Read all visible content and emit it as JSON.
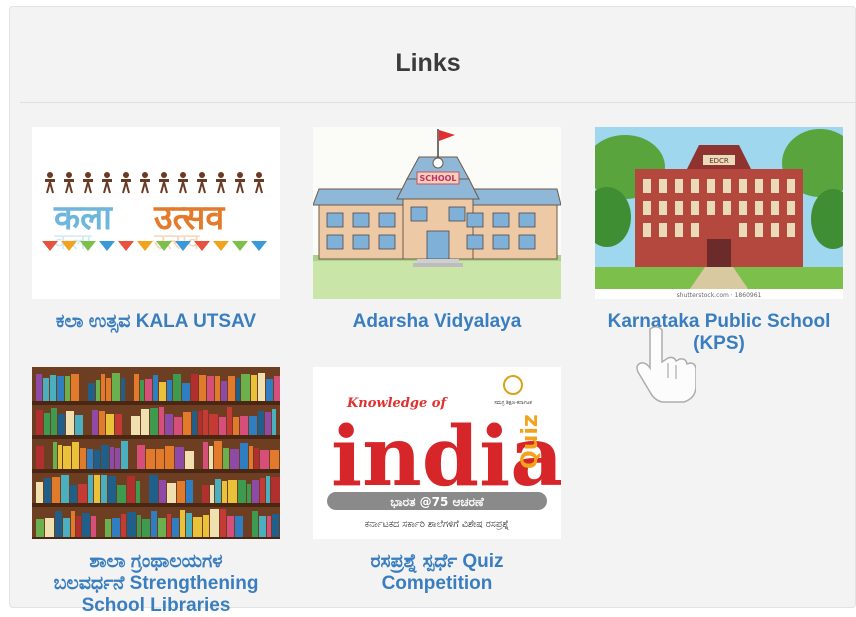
{
  "section": {
    "title": "Links"
  },
  "cards": [
    {
      "label_lines": [
        "ಕಲಾ ಉತ್ಸವ KALA UTSAV"
      ],
      "image": "kala-utsav-logo"
    },
    {
      "label_lines": [
        "Adarsha Vidyalaya"
      ],
      "image": "school-building-drawing",
      "sign_text": "SCHOOL"
    },
    {
      "label_lines": [
        "Karnataka Public School",
        "(KPS)"
      ],
      "image": "public-school-illustration",
      "sign_text": "EDCR",
      "caption": "shutterstock.com · 1860961"
    },
    {
      "label_lines": [
        "ಶಾಲಾ ಗ್ರಂಥಾಲಯಗಳ",
        "ಬಲವರ್ಧನೆ Strengthening",
        "School Libraries"
      ],
      "image": "bookshelf-library"
    },
    {
      "label_lines": [
        "ರಸಪ್ರಶ್ನೆ ಸ್ಪರ್ಧೆ Quiz",
        "Competition"
      ],
      "image": "knowledge-of-india-quiz",
      "quiz": {
        "top": "Knowledge of",
        "main": "india",
        "side": "Quiz",
        "band": "ಭಾರತ @75 ಆಚರಣೆ",
        "sub": "ಕರ್ನಾಟಕದ ಸರ್ಕಾರಿ ಶಾಲೆಗಳಿಗೆ ವಿಶೇಷ ರಸಪ್ರಶ್ನೆ",
        "emblem_text": "ಸಮಗ್ರ ಶಿಕ್ಷಣ-ಕರ್ನಾಟಕ"
      }
    }
  ],
  "colors": {
    "label": "#3a7ec0",
    "title": "#3b3b3b",
    "panel": "#f3f3f3"
  },
  "cursor": {
    "icon": "hand-pointer-icon"
  }
}
